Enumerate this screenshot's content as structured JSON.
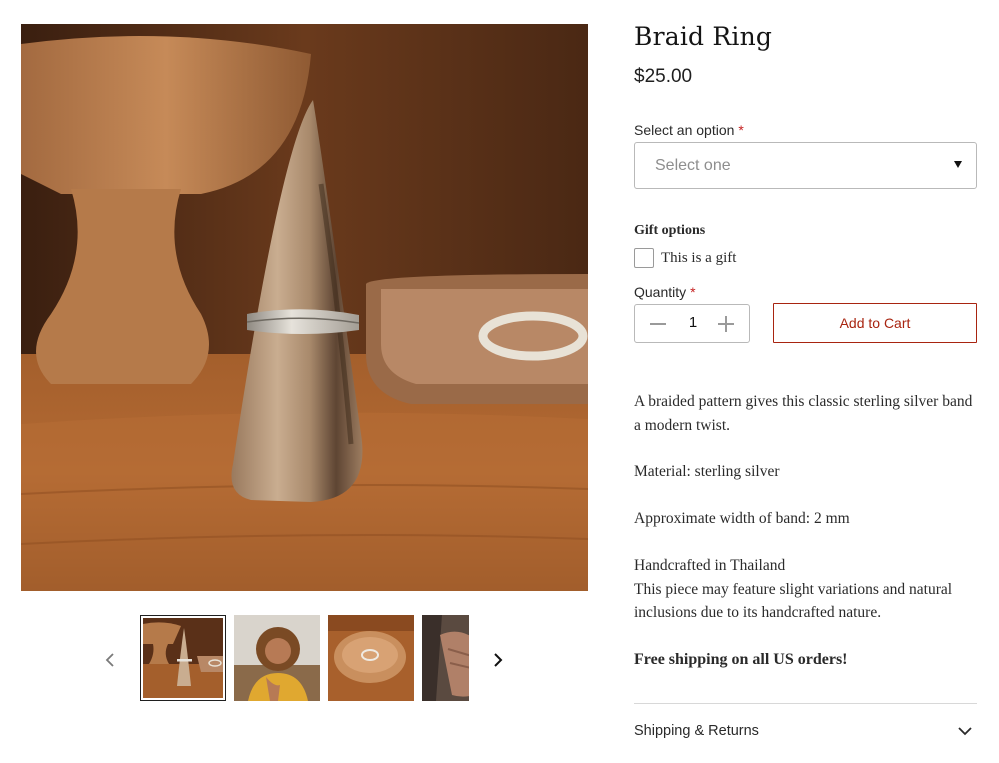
{
  "product": {
    "title": "Braid Ring",
    "price": "$25.00"
  },
  "gallery": {
    "main_image": "braid-ring-on-wooden-cone",
    "thumbnails": [
      {
        "subject": "ring on wooden cone",
        "selected": true
      },
      {
        "subject": "woman wearing ring",
        "selected": false
      },
      {
        "subject": "ring on wooden dish",
        "selected": false
      },
      {
        "subject": "hands with rings",
        "selected": false
      }
    ],
    "prev_icon": "chevron-left-icon",
    "next_icon": "chevron-right-icon"
  },
  "options": {
    "label": "Select an option",
    "required_mark": "*",
    "selected_value": "Select one"
  },
  "gift": {
    "heading": "Gift options",
    "checkbox_label": "This is a gift",
    "checked": false
  },
  "quantity": {
    "label": "Quantity",
    "required_mark": "*",
    "value": "1"
  },
  "cart": {
    "button_label": "Add to Cart"
  },
  "description": {
    "p1": "A braided pattern gives this classic sterling silver band a modern twist.",
    "p2": "Material: sterling silver",
    "p3": "Approximate width of band: 2 mm",
    "p4_line1": "Handcrafted in Thailand",
    "p4_line2": "This piece may feature slight variations and natural inclusions due to its handcrafted nature.",
    "shipping_note": "Free shipping on all US orders!"
  },
  "accordion": {
    "label": "Shipping & Returns",
    "expanded": false
  },
  "colors": {
    "accent": "#a82410",
    "required": "#c51f1f",
    "text": "#2a2a2a",
    "border": "#b9b9b9"
  }
}
